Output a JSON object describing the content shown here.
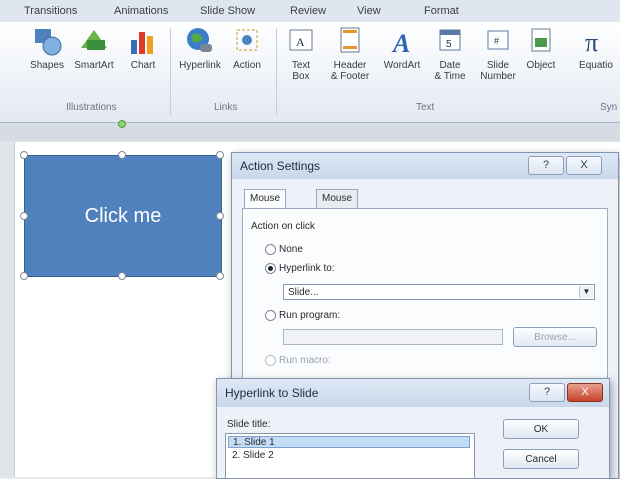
{
  "ribbon": {
    "tabs": [
      "Transitions",
      "Animations",
      "Slide Show",
      "Review",
      "View",
      "Format"
    ],
    "buttons": {
      "shapes": "Shapes",
      "smartart": "SmartArt",
      "chart": "Chart",
      "hyperlink": "Hyperlink",
      "action": "Action",
      "textbox_1": "Text",
      "textbox_2": "Box",
      "header_1": "Header",
      "header_2": "& Footer",
      "wordart": "WordArt",
      "datetime_1": "Date",
      "datetime_2": "& Time",
      "slidenum_1": "Slide",
      "slidenum_2": "Number",
      "object": "Object",
      "equation": "Equatio"
    },
    "groups": {
      "illustrations": "Illustrations",
      "links": "Links",
      "text": "Text",
      "symbols": "Syn"
    }
  },
  "slide": {
    "shape_text": "Click me"
  },
  "action_settings": {
    "title": "Action Settings",
    "help": "?",
    "close": "X",
    "tab_mouse_click": "Mouse Click",
    "tab_mouse_over": "Mouse Over",
    "section_label": "Action on click",
    "opt_none": "None",
    "opt_hyperlink": "Hyperlink to:",
    "hyperlink_value": "Slide...",
    "opt_run_program": "Run program:",
    "browse": "Browse...",
    "opt_run_macro": "Run macro:"
  },
  "hyperlink_to_slide": {
    "title": "Hyperlink to Slide",
    "help": "?",
    "close": "X",
    "label": "Slide title:",
    "items": [
      "1. Slide 1",
      "2. Slide 2"
    ],
    "ok": "OK",
    "cancel": "Cancel"
  }
}
